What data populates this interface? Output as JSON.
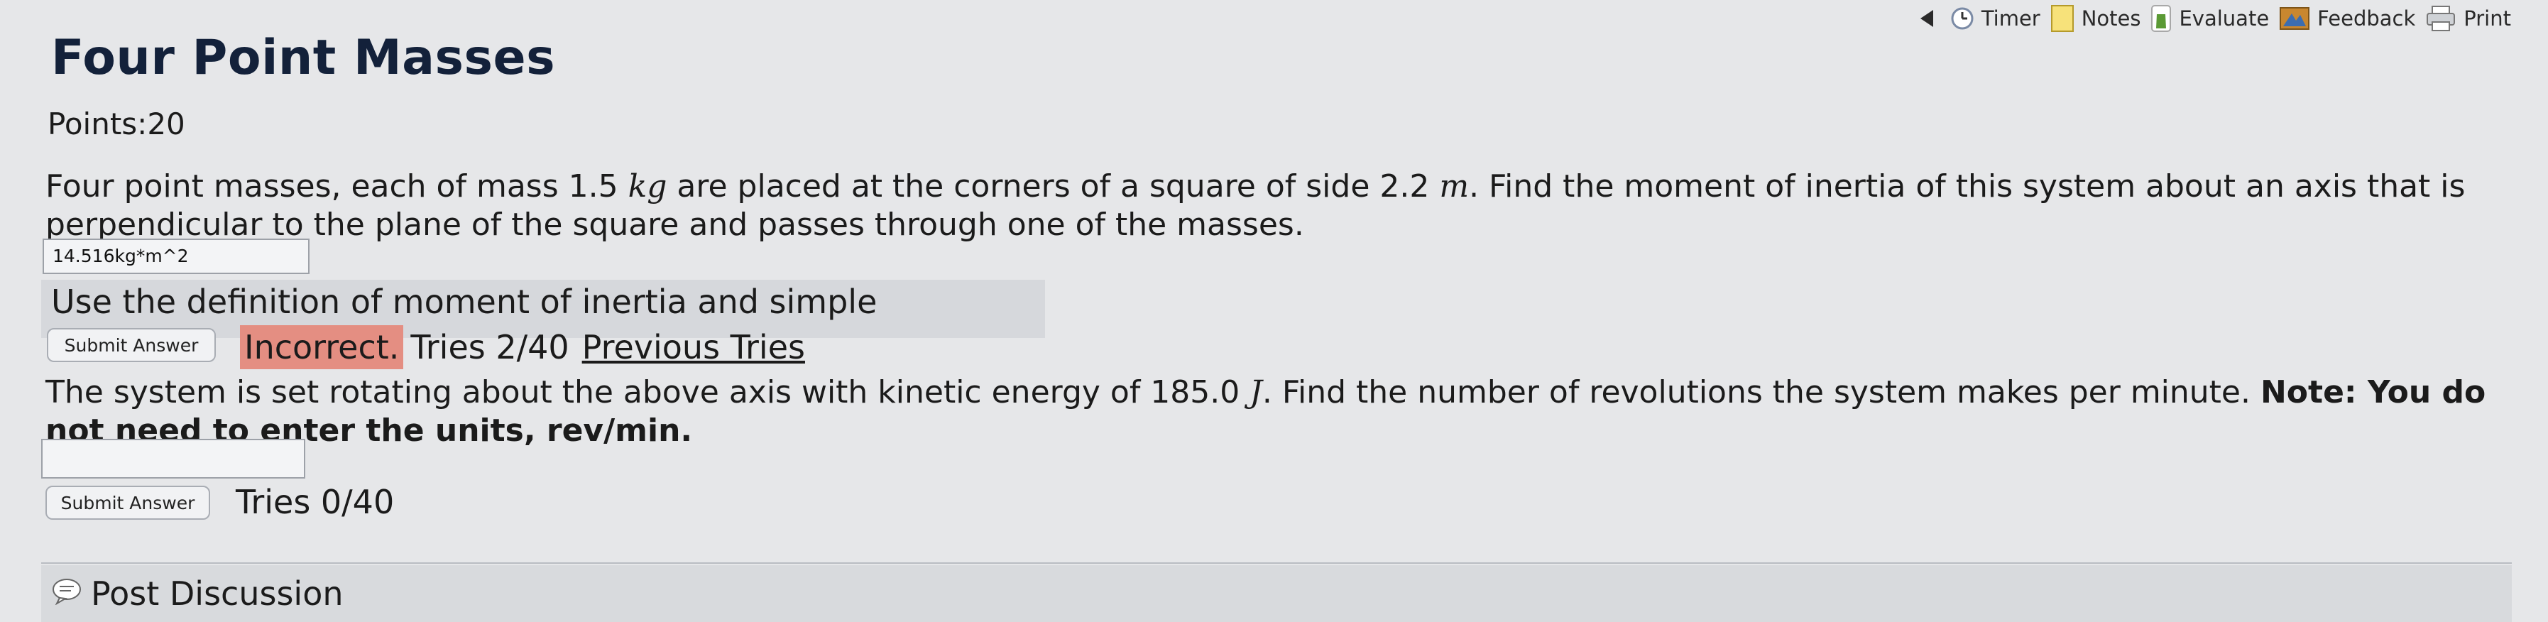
{
  "toolbar": {
    "timer": "Timer",
    "notes": "Notes",
    "evaluate": "Evaluate",
    "feedback": "Feedback",
    "print": "Print"
  },
  "title": "Four Point Masses",
  "points": "Points:20",
  "problem": {
    "part1_a": "Four point masses, each of mass 1.5 ",
    "part1_unit_kg": "kg",
    "part1_b": " are placed at the corners of a square of side 2.2 ",
    "part1_unit_m": "m",
    "part1_c": ". Find the moment of inertia of this system about an axis that is perpendicular to the plane of the square and passes through one of the masses.",
    "answer1_value": "14.516kg*m^2",
    "hint": "Use the definition of moment of inertia and simple geometry.",
    "submit1_label": "Submit Answer",
    "incorrect": "Incorrect.",
    "tries1": "Tries 2/40",
    "previous_tries": "Previous Tries",
    "part2_a": "The system is set rotating about the above axis with kinetic energy of 185.0 ",
    "part2_unit_J": "J",
    "part2_b": ". Find the number of revolutions the system makes per minute. ",
    "part2_note": "Note: You do not need to enter the units, rev/min.",
    "answer2_value": "",
    "submit2_label": "Submit Answer",
    "tries2": "Tries 0/40"
  },
  "discussion": "Post Discussion",
  "colors": {
    "incorrect_bg": "#e48e82",
    "page_bg": "#e6e7e9",
    "title": "#13213a"
  }
}
